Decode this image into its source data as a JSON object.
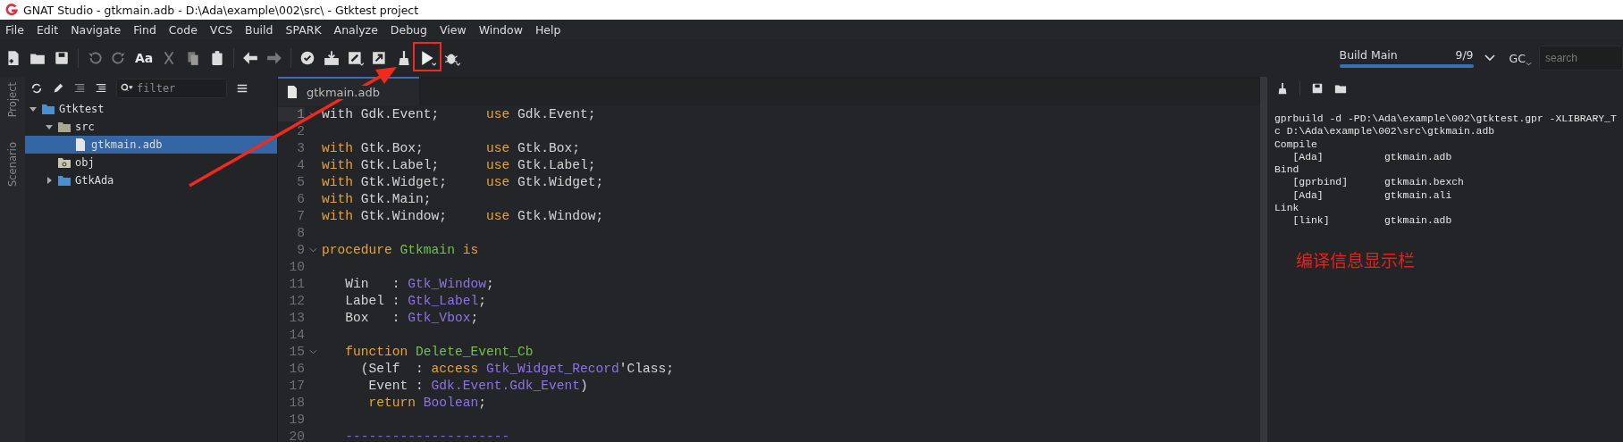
{
  "window": {
    "title": "GNAT Studio - gtkmain.adb - D:\\Ada\\example\\002\\src\\ - Gtktest project"
  },
  "menu": [
    "File",
    "Edit",
    "Navigate",
    "Find",
    "Code",
    "VCS",
    "Build",
    "SPARK",
    "Analyze",
    "Debug",
    "View",
    "Window",
    "Help"
  ],
  "toolbar": {
    "font_button": "Aa",
    "build_status": {
      "label": "Build Main",
      "count": "9/9",
      "level": 1
    },
    "gc_label": "GC",
    "search": {
      "placeholder": "search"
    }
  },
  "side_tabs": [
    "Project",
    "Scenario"
  ],
  "project": {
    "filter": {
      "placeholder": "filter"
    },
    "tree": [
      {
        "label": "Gtktest",
        "kind": "project",
        "expanded": true,
        "selected": false,
        "children": [
          {
            "label": "src",
            "kind": "folder",
            "expanded": true,
            "selected": false,
            "children": [
              {
                "label": "gtkmain.adb",
                "kind": "file",
                "selected": true
              }
            ]
          },
          {
            "label": "obj",
            "kind": "objdir",
            "selected": false
          },
          {
            "label": "GtkAda",
            "kind": "project",
            "expanded": false,
            "selected": false
          }
        ]
      }
    ]
  },
  "editor": {
    "tab": "gtkmain.adb",
    "lines": [
      {
        "number": "1",
        "fold": true,
        "current": true,
        "tokens": [
          {
            "text": "with Gdk.Event;      ",
            "kind": "plain"
          },
          {
            "text": "use",
            "kind": "keyword"
          },
          {
            "text": " Gdk.Event;",
            "kind": "plain"
          }
        ]
      },
      {
        "number": "2",
        "fold": false,
        "current": false
      },
      {
        "number": "3",
        "fold": false,
        "current": false,
        "tokens": [
          {
            "text": "with",
            "kind": "keyword"
          },
          {
            "text": " Gtk.Box;        ",
            "kind": "plain"
          },
          {
            "text": "use",
            "kind": "keyword"
          },
          {
            "text": " Gtk.Box;",
            "kind": "plain"
          }
        ]
      },
      {
        "number": "4",
        "fold": false,
        "current": false,
        "tokens": [
          {
            "text": "with",
            "kind": "keyword"
          },
          {
            "text": " Gtk.Label;      ",
            "kind": "plain"
          },
          {
            "text": "use",
            "kind": "keyword"
          },
          {
            "text": " Gtk.Label;",
            "kind": "plain"
          }
        ]
      },
      {
        "number": "5",
        "fold": false,
        "current": false,
        "tokens": [
          {
            "text": "with",
            "kind": "keyword"
          },
          {
            "text": " Gtk.Widget;     ",
            "kind": "plain"
          },
          {
            "text": "use",
            "kind": "keyword"
          },
          {
            "text": " Gtk.Widget;",
            "kind": "plain"
          }
        ]
      },
      {
        "number": "6",
        "fold": false,
        "current": false,
        "tokens": [
          {
            "text": "with",
            "kind": "keyword"
          },
          {
            "text": " Gtk.Main;",
            "kind": "plain"
          }
        ]
      },
      {
        "number": "7",
        "fold": false,
        "current": false,
        "tokens": [
          {
            "text": "with",
            "kind": "keyword"
          },
          {
            "text": " Gtk.Window;     ",
            "kind": "plain"
          },
          {
            "text": "use",
            "kind": "keyword"
          },
          {
            "text": " Gtk.Window;",
            "kind": "plain"
          }
        ]
      },
      {
        "number": "8",
        "fold": false,
        "current": false
      },
      {
        "number": "9",
        "fold": true,
        "current": false,
        "tokens": [
          {
            "text": "procedure",
            "kind": "keyword"
          },
          {
            "text": " Gtkmain",
            "kind": "name"
          },
          {
            "text": " is",
            "kind": "keyword"
          }
        ]
      },
      {
        "number": "10",
        "fold": false,
        "current": false
      },
      {
        "number": "11",
        "fold": false,
        "current": false,
        "tokens": [
          {
            "text": "   Win   : ",
            "kind": "plain"
          },
          {
            "text": "Gtk_Window",
            "kind": "type"
          },
          {
            "text": ";",
            "kind": "plain"
          }
        ]
      },
      {
        "number": "12",
        "fold": false,
        "current": false,
        "tokens": [
          {
            "text": "   Label : ",
            "kind": "plain"
          },
          {
            "text": "Gtk_Label",
            "kind": "type"
          },
          {
            "text": ";",
            "kind": "plain"
          }
        ]
      },
      {
        "number": "13",
        "fold": false,
        "current": false,
        "tokens": [
          {
            "text": "   Box   : ",
            "kind": "plain"
          },
          {
            "text": "Gtk_Vbox",
            "kind": "type"
          },
          {
            "text": ";",
            "kind": "plain"
          }
        ]
      },
      {
        "number": "14",
        "fold": false,
        "current": false
      },
      {
        "number": "15",
        "fold": true,
        "current": false,
        "tokens": [
          {
            "text": "   function",
            "kind": "keyword"
          },
          {
            "text": " Delete_Event_Cb",
            "kind": "name"
          }
        ]
      },
      {
        "number": "16",
        "fold": false,
        "current": false,
        "tokens": [
          {
            "text": "     (Self  : ",
            "kind": "plain"
          },
          {
            "text": "access",
            "kind": "keyword"
          },
          {
            "text": " Gtk_Widget_Record",
            "kind": "type"
          },
          {
            "text": "'Class;",
            "kind": "plain"
          }
        ]
      },
      {
        "number": "17",
        "fold": false,
        "current": false,
        "tokens": [
          {
            "text": "      Event : ",
            "kind": "plain"
          },
          {
            "text": "Gdk.Event.Gdk_Event",
            "kind": "type"
          },
          {
            "text": ")",
            "kind": "plain"
          }
        ]
      },
      {
        "number": "18",
        "fold": false,
        "current": false,
        "tokens": [
          {
            "text": "      return",
            "kind": "keyword"
          },
          {
            "text": " Boolean",
            "kind": "type"
          },
          {
            "text": ";",
            "kind": "plain"
          }
        ]
      },
      {
        "number": "19",
        "fold": false,
        "current": false
      },
      {
        "number": "20",
        "fold": false,
        "current": false,
        "tokens": [
          {
            "text": "   ---------------------",
            "kind": "comment"
          }
        ]
      }
    ]
  },
  "output": {
    "lines": [
      "gprbuild -d -PD:\\Ada\\example\\002\\gtktest.gpr -XLIBRARY_T",
      "c D:\\Ada\\example\\002\\src\\gtkmain.adb",
      "Compile",
      "   [Ada]          gtkmain.adb",
      "Bind",
      "   [gprbind]      gtkmain.bexch",
      "   [Ada]          gtkmain.ali",
      "Link",
      "   [link]         gtkmain.adb"
    ],
    "annotation": "编译信息显示栏"
  }
}
